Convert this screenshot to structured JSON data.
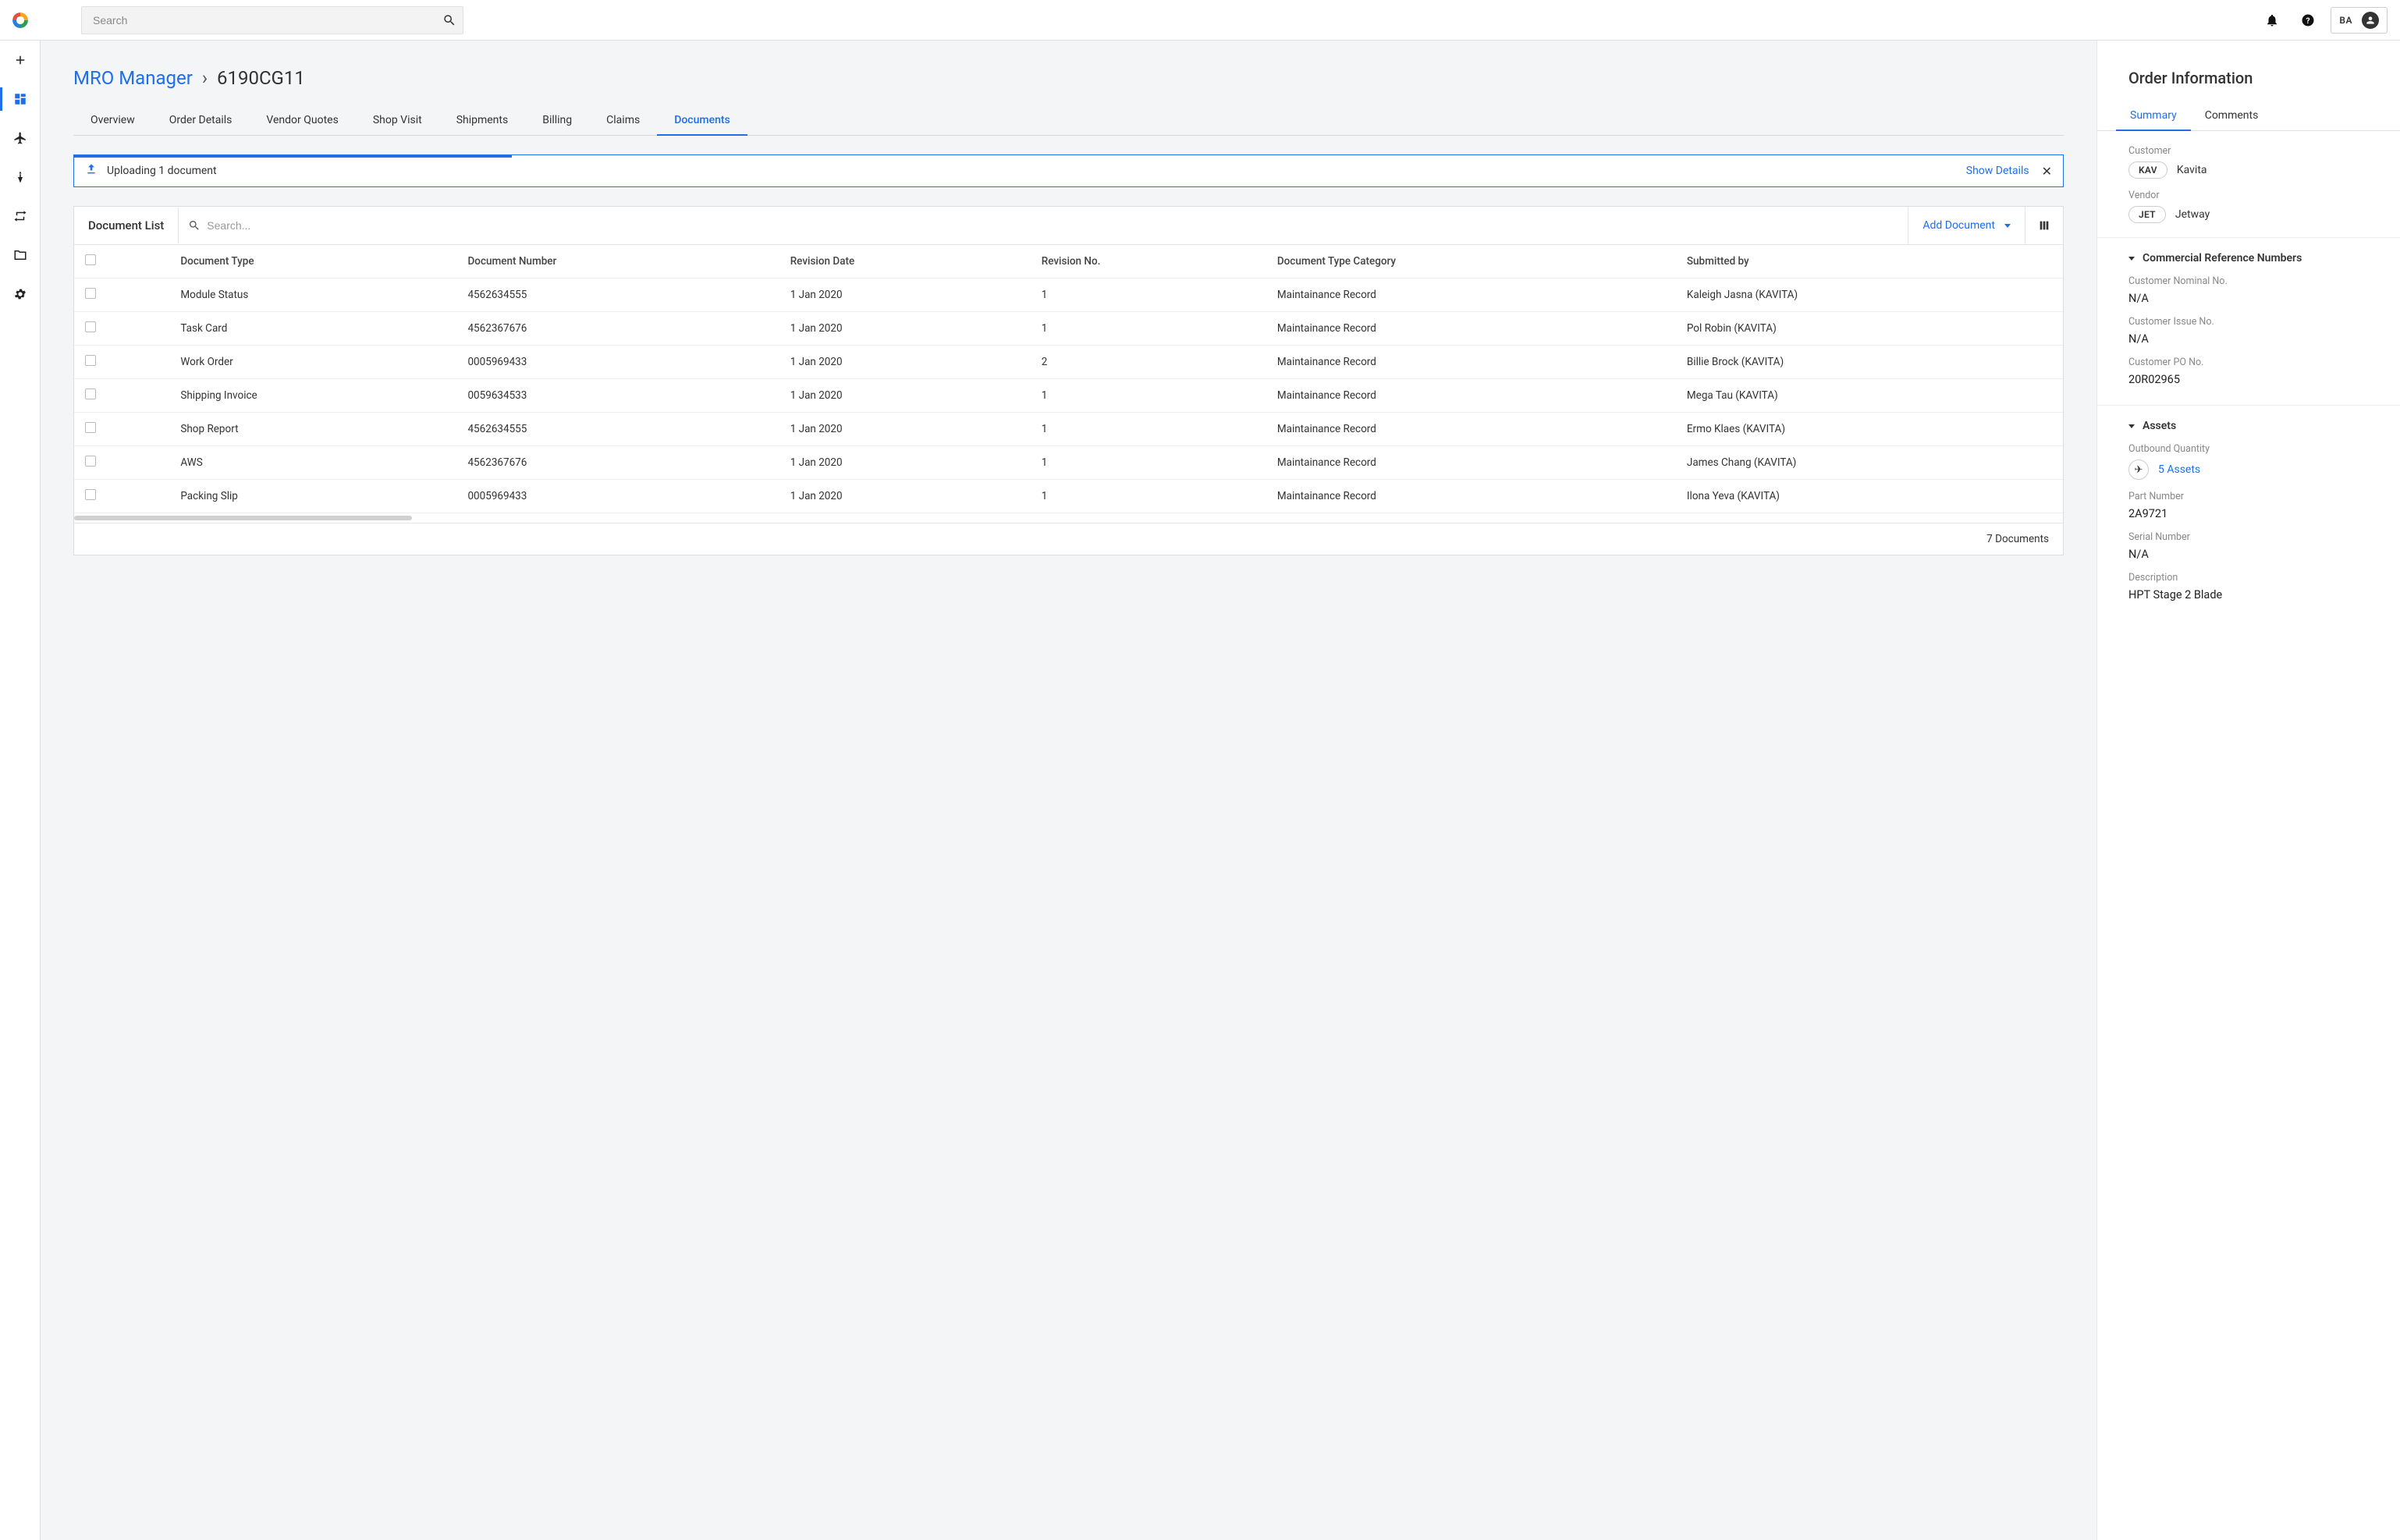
{
  "search": {
    "placeholder": "Search"
  },
  "user": {
    "initials": "BA"
  },
  "breadcrumb": {
    "root": "MRO Manager",
    "sep": "›",
    "current": "6190CG11"
  },
  "tabs": [
    "Overview",
    "Order Details",
    "Vendor Quotes",
    "Shop Visit",
    "Shipments",
    "Billing",
    "Claims",
    "Documents"
  ],
  "active_tab": "Documents",
  "upload": {
    "text": "Uploading 1 document",
    "show_details": "Show Details"
  },
  "doclist": {
    "title": "Document List",
    "search_placeholder": "Search...",
    "add_label": "Add Document",
    "columns": [
      "Document Type",
      "Document Number",
      "Revision Date",
      "Revision No.",
      "Document Type Category",
      "Submitted by"
    ],
    "rows": [
      {
        "type": "Module Status",
        "num": "4562634555",
        "date": "1 Jan 2020",
        "rev": "1",
        "cat": "Maintainance Record",
        "by": "Kaleigh Jasna (KAVITA)"
      },
      {
        "type": "Task Card",
        "num": "4562367676",
        "date": "1 Jan 2020",
        "rev": "1",
        "cat": "Maintainance Record",
        "by": "Pol Robin (KAVITA)"
      },
      {
        "type": "Work Order",
        "num": "0005969433",
        "date": "1 Jan 2020",
        "rev": "2",
        "cat": "Maintainance Record",
        "by": "Billie Brock (KAVITA)"
      },
      {
        "type": "Shipping Invoice",
        "num": "0059634533",
        "date": "1 Jan 2020",
        "rev": "1",
        "cat": "Maintainance Record",
        "by": "Mega Tau (KAVITA)"
      },
      {
        "type": "Shop Report",
        "num": "4562634555",
        "date": "1 Jan 2020",
        "rev": "1",
        "cat": "Maintainance Record",
        "by": "Ermo Klaes (KAVITA)"
      },
      {
        "type": "AWS",
        "num": "4562367676",
        "date": "1 Jan 2020",
        "rev": "1",
        "cat": "Maintainance Record",
        "by": "James Chang (KAVITA)"
      },
      {
        "type": "Packing Slip",
        "num": "0005969433",
        "date": "1 Jan 2020",
        "rev": "1",
        "cat": "Maintainance Record",
        "by": "Ilona Yeva (KAVITA)"
      }
    ],
    "footer": "7 Documents"
  },
  "info": {
    "title": "Order Information",
    "tabs": [
      "Summary",
      "Comments"
    ],
    "active_tab": "Summary",
    "customer_label": "Customer",
    "customer_chip": "KAV",
    "customer_name": "Kavita",
    "vendor_label": "Vendor",
    "vendor_chip": "JET",
    "vendor_name": "Jetway",
    "section_commercial": "Commercial Reference Numbers",
    "cust_nominal_label": "Customer Nominal No.",
    "cust_nominal_val": "N/A",
    "cust_issue_label": "Customer Issue No.",
    "cust_issue_val": "N/A",
    "cust_po_label": "Customer PO No.",
    "cust_po_val": "20R02965",
    "section_assets": "Assets",
    "outbound_label": "Outbound Quantity",
    "assets_link": "5 Assets",
    "partnum_label": "Part Number",
    "partnum_val": "2A9721",
    "serial_label": "Serial Number",
    "serial_val": "N/A",
    "desc_label": "Description",
    "desc_val": "HPT Stage 2 Blade"
  }
}
